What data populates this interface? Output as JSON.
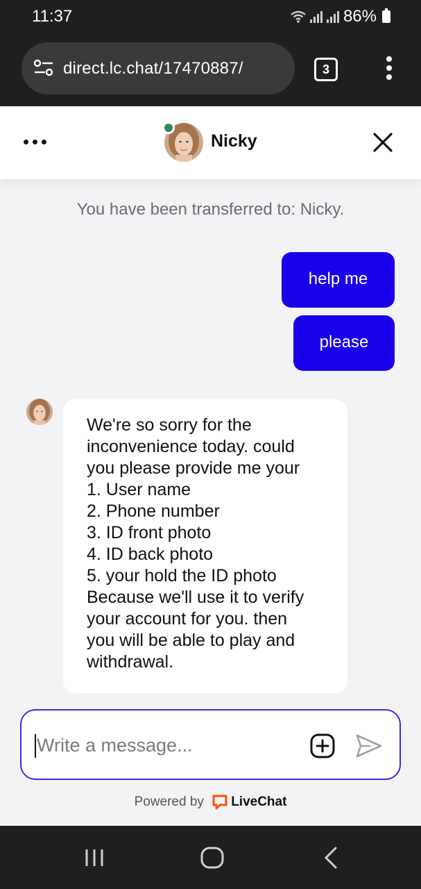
{
  "status_bar": {
    "time": "11:37",
    "battery": "86%"
  },
  "browser": {
    "url": "direct.lc.chat/17470887/",
    "tab_count": "3"
  },
  "chat_header": {
    "agent_name": "Nicky",
    "online_status_color": "#2e8b57"
  },
  "chat": {
    "system_note": "You have been transferred to: Nicky.",
    "outgoing_messages": [
      {
        "text": "help me"
      },
      {
        "text": "please"
      }
    ],
    "incoming_message_lines": [
      "We're so sorry for the",
      "inconvenience today. could",
      "you please provide me your",
      "1. User name",
      "2. Phone number",
      "3. ID front photo",
      "4. ID back photo",
      "5. your hold the ID photo",
      "Because we'll use it to verify",
      "your account for you. then",
      "you will be able to play and",
      "withdrawal."
    ],
    "outgoing_bubble_color": "#1a00e8"
  },
  "composer": {
    "placeholder": "Write a message...",
    "value": ""
  },
  "footer": {
    "powered_by": "Powered by",
    "brand": "LiveChat",
    "brand_color": "#ff5100"
  },
  "icons": {
    "more": "more-horizontal-icon",
    "close": "close-icon",
    "attach": "add-attachment-icon",
    "send": "send-icon",
    "site_info": "site-settings-icon",
    "browser_menu": "more-vertical-icon"
  }
}
